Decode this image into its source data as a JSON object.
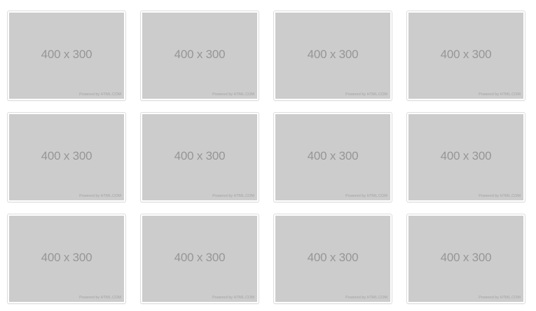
{
  "gallery": {
    "items": [
      {
        "size_label": "400 x 300",
        "credit": "Powered by HTML.COM"
      },
      {
        "size_label": "400 x 300",
        "credit": "Powered by HTML.COM"
      },
      {
        "size_label": "400 x 300",
        "credit": "Powered by HTML.COM"
      },
      {
        "size_label": "400 x 300",
        "credit": "Powered by HTML.COM"
      },
      {
        "size_label": "400 x 300",
        "credit": "Powered by HTML.COM"
      },
      {
        "size_label": "400 x 300",
        "credit": "Powered by HTML.COM"
      },
      {
        "size_label": "400 x 300",
        "credit": "Powered by HTML.COM"
      },
      {
        "size_label": "400 x 300",
        "credit": "Powered by HTML.COM"
      },
      {
        "size_label": "400 x 300",
        "credit": "Powered by HTML.COM"
      },
      {
        "size_label": "400 x 300",
        "credit": "Powered by HTML.COM"
      },
      {
        "size_label": "400 x 300",
        "credit": "Powered by HTML.COM"
      },
      {
        "size_label": "400 x 300",
        "credit": "Powered by HTML.COM"
      }
    ]
  },
  "colors": {
    "placeholder_bg": "#cccccc",
    "placeholder_text": "#969696",
    "frame_border": "#dddddd"
  }
}
